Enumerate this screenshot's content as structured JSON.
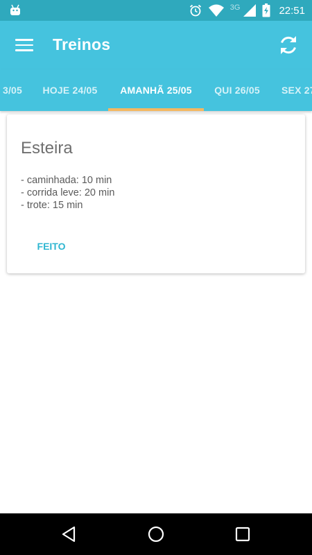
{
  "status_bar": {
    "network_label": "3G",
    "time": "22:51",
    "icons": [
      "android-icon",
      "alarm-icon",
      "wifi-icon",
      "signal-icon",
      "battery-charging-icon"
    ]
  },
  "app_bar": {
    "title": "Treinos",
    "left_icon": "menu-icon",
    "right_icon": "refresh-icon",
    "background_color": "#45c3de"
  },
  "tabs": {
    "items": [
      {
        "label": "3/05"
      },
      {
        "label": "HOJE 24/05"
      },
      {
        "label": "AMANHÃ 25/05"
      },
      {
        "label": "QUI 26/05"
      },
      {
        "label": "SEX 27"
      }
    ],
    "active_index": 2,
    "indicator_color": "#f4b860"
  },
  "workout_card": {
    "title": "Esteira",
    "lines": [
      "- caminhada: 10 min",
      "- corrida leve: 20 min",
      "- trote: 15 min"
    ],
    "action_label": "FEITO",
    "action_color": "#2fb6d1"
  },
  "nav_bar": {
    "icons": [
      "back-icon",
      "home-icon",
      "recents-icon"
    ]
  }
}
